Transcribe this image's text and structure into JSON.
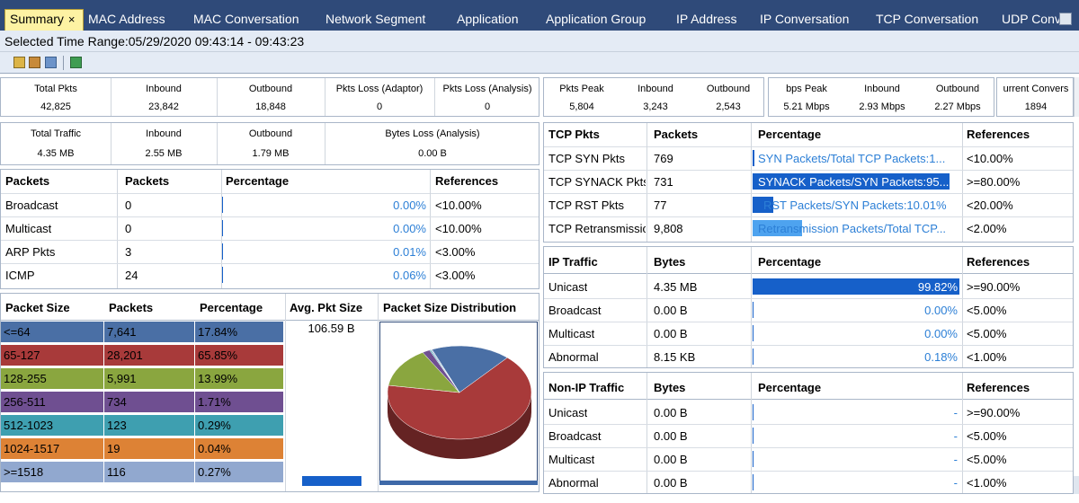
{
  "tabs": [
    {
      "label": "Summary",
      "active": true
    },
    {
      "label": "MAC Address"
    },
    {
      "label": "MAC Conversation"
    },
    {
      "label": "Network Segment"
    },
    {
      "label": "Application"
    },
    {
      "label": "Application Group"
    },
    {
      "label": "IP Address"
    },
    {
      "label": "IP Conversation"
    },
    {
      "label": "TCP Conversation"
    },
    {
      "label": "UDP Conv"
    }
  ],
  "time_range": "Selected Time Range:05/29/2020 09:43:14 - 09:43:23",
  "toolbar_icons": [
    "export-icon",
    "copy-icon",
    "chart-icon",
    "refresh-icon"
  ],
  "pkts_summary": {
    "headers": [
      "Total Pkts",
      "Inbound",
      "Outbound",
      "Pkts Loss (Adaptor)",
      "Pkts Loss (Analysis)"
    ],
    "values": [
      "42,825",
      "23,842",
      "18,848",
      "0",
      "0"
    ]
  },
  "traffic_summary": {
    "headers": [
      "Total Traffic",
      "Inbound",
      "Outbound",
      "Bytes Loss (Analysis)"
    ],
    "values": [
      "4.35 MB",
      "2.55 MB",
      "1.79 MB",
      "0.00 B"
    ]
  },
  "pkts_peak": {
    "headers": [
      "Pkts Peak",
      "Inbound",
      "Outbound"
    ],
    "values": [
      "5,804",
      "3,243",
      "2,543"
    ]
  },
  "bps_peak": {
    "headers": [
      "bps Peak",
      "Inbound",
      "Outbound"
    ],
    "values": [
      "5.21 Mbps",
      "2.93 Mbps",
      "2.27 Mbps"
    ]
  },
  "conv": {
    "header": "urrent Convers",
    "value": "1894"
  },
  "packets_table": {
    "headers": [
      "Packets",
      "Packets",
      "Percentage",
      "References"
    ],
    "rows": [
      {
        "name": "Broadcast",
        "packets": "0",
        "pct": "0.00%",
        "pct_value": 0,
        "ref": "<10.00%"
      },
      {
        "name": "Multicast",
        "packets": "0",
        "pct": "0.00%",
        "pct_value": 0,
        "ref": "<10.00%"
      },
      {
        "name": "ARP Pkts",
        "packets": "3",
        "pct": "0.01%",
        "pct_value": 0.01,
        "ref": "<3.00%"
      },
      {
        "name": "ICMP",
        "packets": "24",
        "pct": "0.06%",
        "pct_value": 0.06,
        "ref": "<3.00%"
      }
    ]
  },
  "packet_size_table": {
    "headers": [
      "Packet Size",
      "Packets",
      "Percentage",
      "Avg. Pkt Size",
      "Packet Size Distribution"
    ],
    "avg_size": "106.59 B",
    "rows": [
      {
        "size": "<=64",
        "packets": "7,641",
        "pct": "17.84%",
        "color": "#4a6fa5"
      },
      {
        "size": "65-127",
        "packets": "28,201",
        "pct": "65.85%",
        "color": "#a83a3a"
      },
      {
        "size": "128-255",
        "packets": "5,991",
        "pct": "13.99%",
        "color": "#8aa63f"
      },
      {
        "size": "256-511",
        "packets": "734",
        "pct": "1.71%",
        "color": "#6f4f91"
      },
      {
        "size": "512-1023",
        "packets": "123",
        "pct": "0.29%",
        "color": "#3e9fb0"
      },
      {
        "size": "1024-1517",
        "packets": "19",
        "pct": "0.04%",
        "color": "#dd8235"
      },
      {
        "size": ">=1518",
        "packets": "116",
        "pct": "0.27%",
        "color": "#91a8cf"
      }
    ]
  },
  "tcp_table": {
    "headers": [
      "TCP Pkts",
      "Packets",
      "Percentage",
      "References"
    ],
    "rows": [
      {
        "name": "TCP SYN Pkts",
        "packets": "769",
        "pct_text": "SYN Packets/Total TCP Packets:1...",
        "pct_value": 1.0,
        "ref": "<10.00%"
      },
      {
        "name": "TCP SYNACK Pkts",
        "packets": "731",
        "pct_text": "SYNACK Packets/SYN Packets:95...",
        "pct_value": 95.0,
        "ref": ">=80.00%"
      },
      {
        "name": "TCP RST Pkts",
        "packets": "77",
        "pct_text": "RST Packets/SYN Packets:10.01%",
        "pct_value": 10.01,
        "ref": "<20.00%"
      },
      {
        "name": "TCP Retransmission",
        "packets": "9,808",
        "pct_text": "Retransmission Packets/Total TCP...",
        "pct_value": 20,
        "ref": "<2.00%"
      }
    ]
  },
  "ip_table": {
    "headers": [
      "IP Traffic",
      "Bytes",
      "Percentage",
      "References"
    ],
    "rows": [
      {
        "name": "Unicast",
        "bytes": "4.35 MB",
        "pct": "99.82%",
        "pct_value": 99.82,
        "ref": ">=90.00%"
      },
      {
        "name": "Broadcast",
        "bytes": "0.00 B",
        "pct": "0.00%",
        "pct_value": 0,
        "ref": "<5.00%"
      },
      {
        "name": "Multicast",
        "bytes": "0.00 B",
        "pct": "0.00%",
        "pct_value": 0,
        "ref": "<5.00%"
      },
      {
        "name": "Abnormal",
        "bytes": "8.15 KB",
        "pct": "0.18%",
        "pct_value": 0.18,
        "ref": "<1.00%"
      }
    ]
  },
  "non_ip_table": {
    "headers": [
      "Non-IP Traffic",
      "Bytes",
      "Percentage",
      "References"
    ],
    "rows": [
      {
        "name": "Unicast",
        "bytes": "0.00 B",
        "pct": "-",
        "ref": ">=90.00%"
      },
      {
        "name": "Broadcast",
        "bytes": "0.00 B",
        "pct": "-",
        "ref": "<5.00%"
      },
      {
        "name": "Multicast",
        "bytes": "0.00 B",
        "pct": "-",
        "ref": "<5.00%"
      },
      {
        "name": "Abnormal",
        "bytes": "0.00 B",
        "pct": "-",
        "ref": "<1.00%"
      }
    ]
  },
  "colors": {
    "tab_bg": "#2f4a79",
    "active_tab": "#fdf2a3",
    "bar": "#1660c9",
    "bar_light": "#4ea3ef",
    "pct_text": "#2c7fd6"
  }
}
